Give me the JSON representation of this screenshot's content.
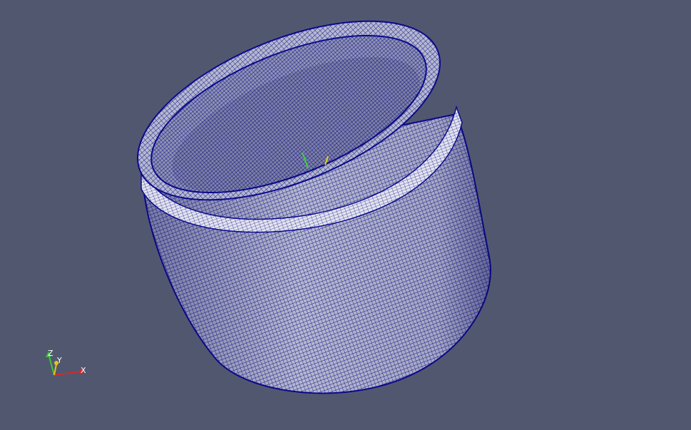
{
  "viewport": {
    "background_color": "#525770",
    "mesh_line_color": "#0a0a8c",
    "mesh_fill_color": "#b9bcd0",
    "rim_highlight_color": "#e8e9f2"
  },
  "orientation_axes": {
    "x_label": "X",
    "y_label": "Y",
    "z_label": "Z",
    "x_color": "#d22a2a",
    "y_color": "#e6c21a",
    "z_color": "#3cc83c"
  },
  "center_axes": {
    "green_color": "#3cd23c",
    "yellow_color": "#e6d21a"
  }
}
